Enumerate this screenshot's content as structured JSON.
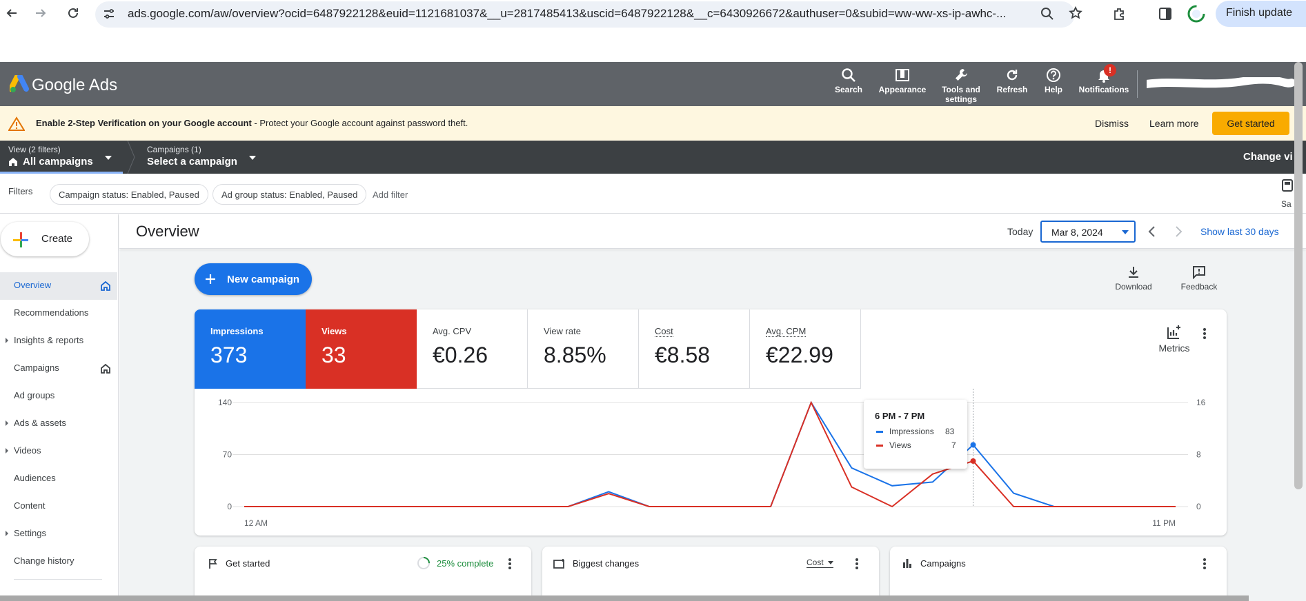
{
  "browser": {
    "url": "ads.google.com/aw/overview?ocid=6487922128&euid=1121681037&__u=2817485413&uscid=6487922128&__c=6430926672&authuser=0&subid=ww-ww-xs-ip-awhc-...",
    "finish_update": "Finish update"
  },
  "header": {
    "brand": "Google Ads",
    "items": [
      {
        "label": "Search"
      },
      {
        "label": "Appearance"
      },
      {
        "label": "Tools and settings"
      },
      {
        "label": "Refresh"
      },
      {
        "label": "Help"
      },
      {
        "label": "Notifications"
      }
    ],
    "notif_badge": "!"
  },
  "notice": {
    "bold": "Enable 2-Step Verification on your Google account",
    "text": " - Protect your Google account against password theft.",
    "dismiss": "Dismiss",
    "learn_more": "Learn more",
    "get_started": "Get started"
  },
  "selector": {
    "view_small": "View (2 filters)",
    "view_big": "All campaigns",
    "camp_small": "Campaigns (1)",
    "camp_big": "Select a campaign",
    "change_view": "Change vi"
  },
  "filters": {
    "label": "Filters",
    "chips": [
      "Campaign status: Enabled, Paused",
      "Ad group status: Enabled, Paused"
    ],
    "add": "Add filter",
    "save_partial": "Sa"
  },
  "sidebar": {
    "create": "Create",
    "items": [
      {
        "label": "Overview"
      },
      {
        "label": "Recommendations"
      },
      {
        "label": "Insights & reports"
      },
      {
        "label": "Campaigns"
      },
      {
        "label": "Ad groups"
      },
      {
        "label": "Ads & assets"
      },
      {
        "label": "Videos"
      },
      {
        "label": "Audiences"
      },
      {
        "label": "Content"
      },
      {
        "label": "Settings"
      },
      {
        "label": "Change history"
      }
    ]
  },
  "main": {
    "title": "Overview",
    "today": "Today",
    "date": "Mar 8, 2024",
    "show_last": "Show last 30 days",
    "new_campaign": "New campaign",
    "download": "Download",
    "feedback": "Feedback",
    "metrics_label": "Metrics"
  },
  "metrics": [
    {
      "label": "Impressions",
      "value": "373"
    },
    {
      "label": "Views",
      "value": "33"
    },
    {
      "label": "Avg. CPV",
      "value": "€0.26"
    },
    {
      "label": "View rate",
      "value": "8.85%"
    },
    {
      "label": "Cost",
      "value": "€8.58"
    },
    {
      "label": "Avg. CPM",
      "value": "€22.99"
    }
  ],
  "tooltip": {
    "title": "6 PM - 7 PM",
    "rows": [
      {
        "name": "Impressions",
        "value": "83"
      },
      {
        "name": "Views",
        "value": "7"
      }
    ]
  },
  "chart_data": {
    "type": "line",
    "x": [
      0,
      1,
      2,
      3,
      4,
      5,
      6,
      7,
      8,
      9,
      10,
      11,
      12,
      13,
      14,
      15,
      16,
      17,
      18,
      19,
      20,
      21,
      22,
      23
    ],
    "x_tick_labels": [
      "12 AM",
      "11 PM"
    ],
    "y_left_ticks": [
      0,
      70,
      140
    ],
    "y_right_ticks": [
      0,
      8,
      16
    ],
    "ylim_left": [
      0,
      140
    ],
    "ylim_right": [
      0,
      16
    ],
    "series": [
      {
        "name": "Impressions",
        "axis": "left",
        "color": "#1a73e8",
        "values": [
          0,
          0,
          0,
          0,
          0,
          0,
          0,
          0,
          0,
          20,
          0,
          0,
          0,
          0,
          140,
          52,
          28,
          33,
          83,
          18,
          0,
          0,
          0,
          0
        ]
      },
      {
        "name": "Views",
        "axis": "right",
        "color": "#d93025",
        "values": [
          0,
          0,
          0,
          0,
          0,
          0,
          0,
          0,
          0,
          2,
          0,
          0,
          0,
          0,
          16,
          3,
          0,
          5,
          7,
          0,
          0,
          0,
          0,
          0
        ]
      }
    ],
    "highlight_index": 18,
    "grid": true
  },
  "bottom_cards": {
    "get_started": "Get started",
    "progress": "25% complete",
    "progress_value": 0.25,
    "biggest_changes": "Biggest changes",
    "cost": "Cost",
    "campaigns": "Campaigns"
  }
}
